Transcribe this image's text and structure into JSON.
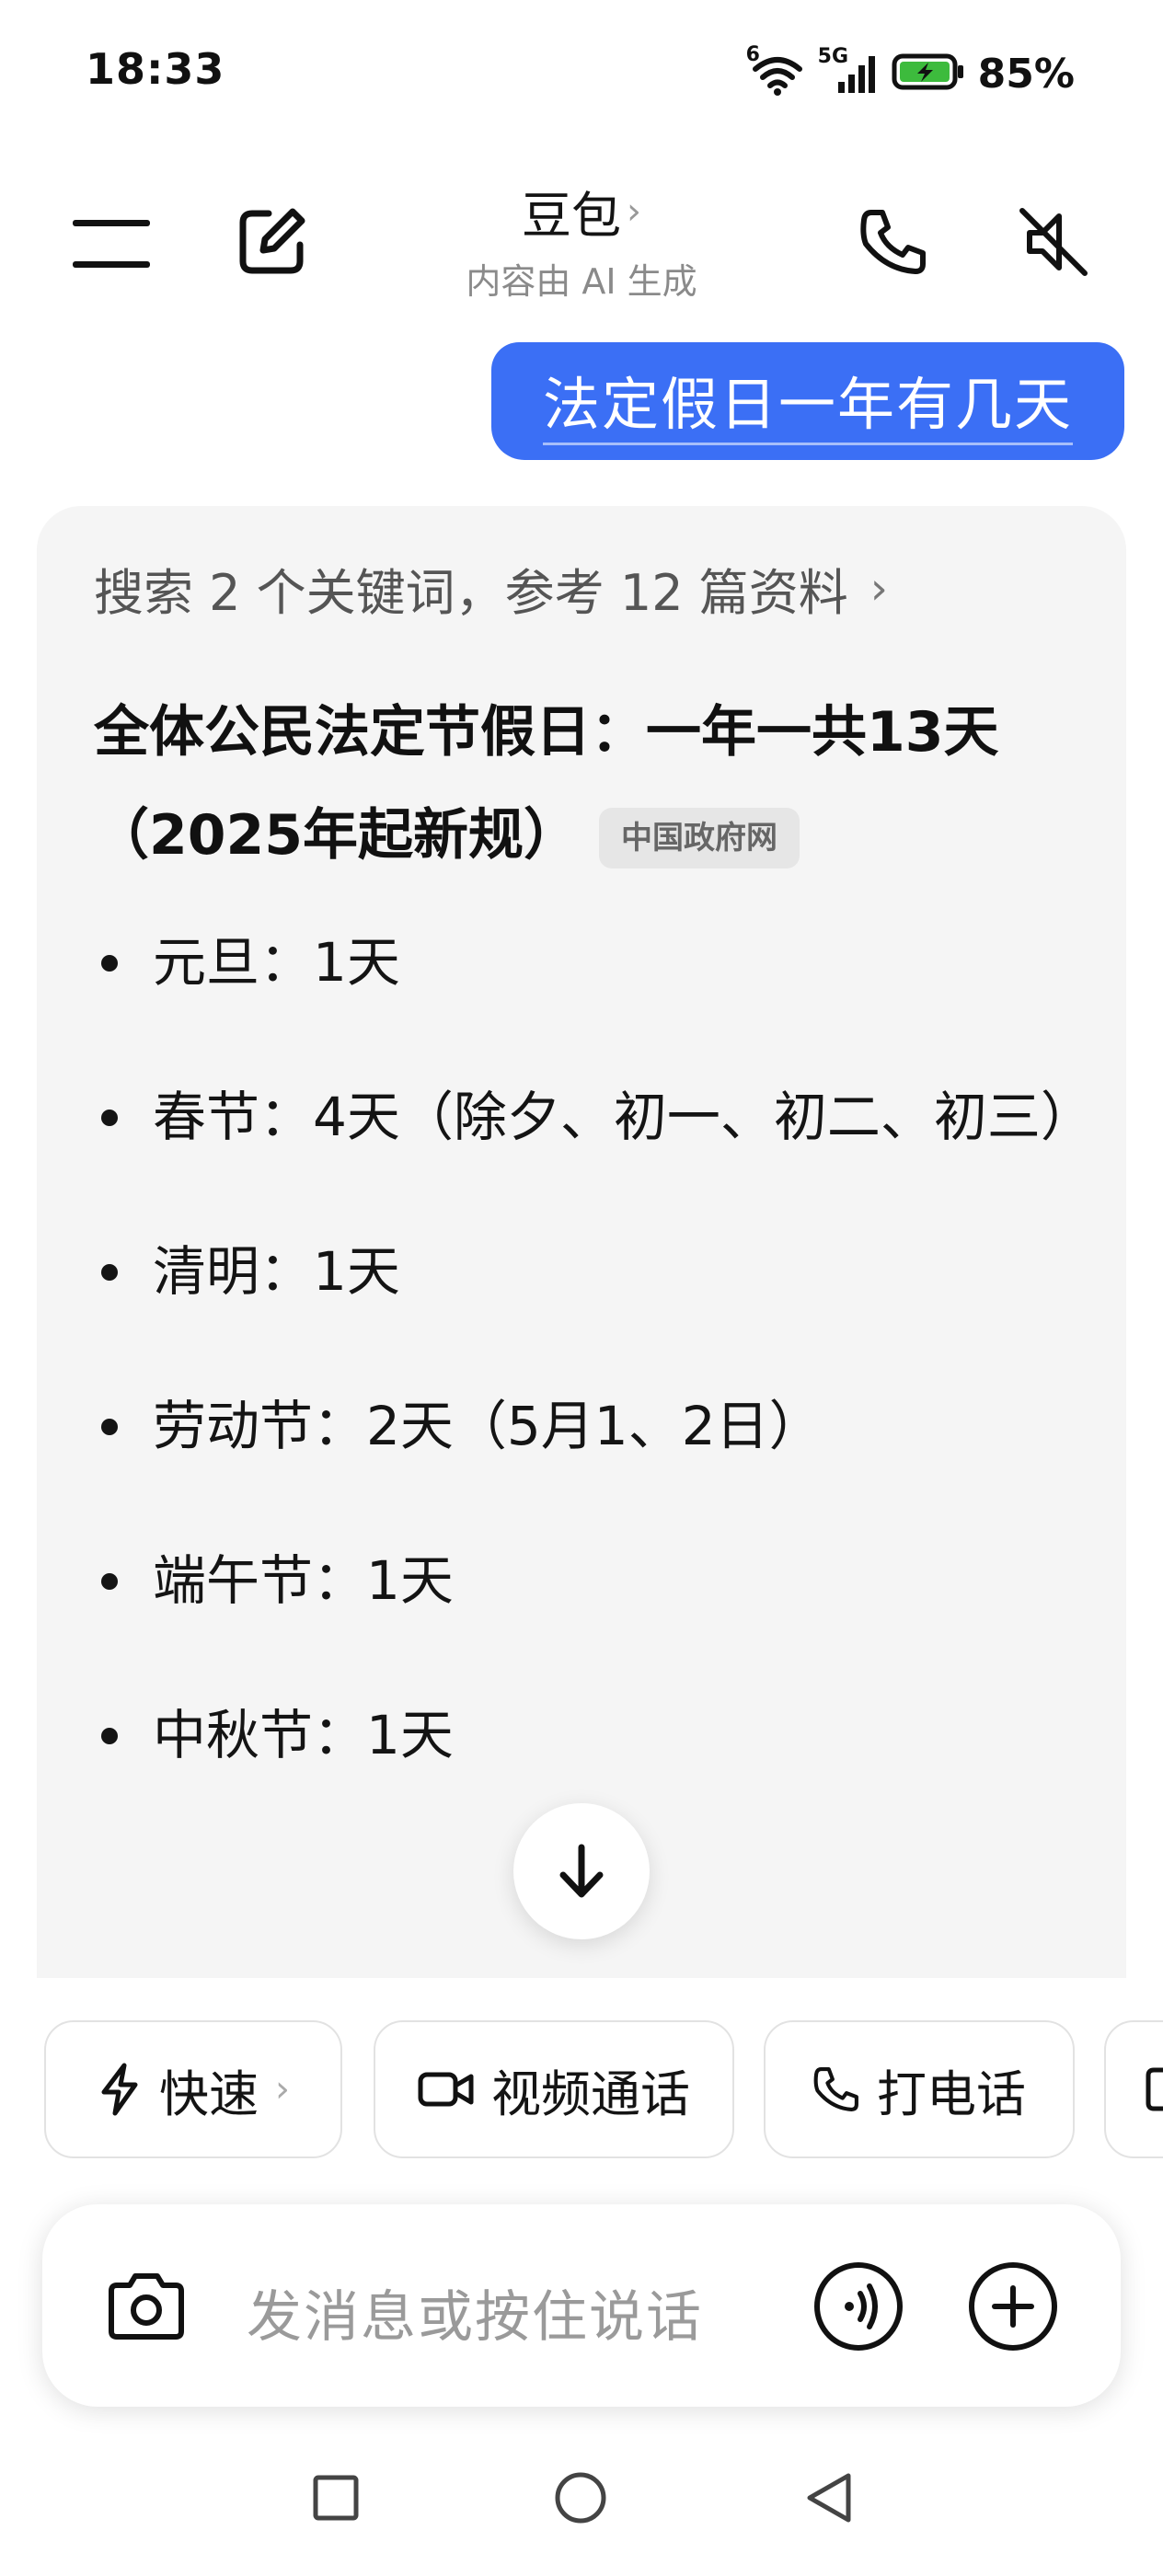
{
  "status_bar": {
    "time": "18:33",
    "network": "5G",
    "wifi_badge": "6",
    "battery_percent": "85%"
  },
  "header": {
    "title": "豆包",
    "subtitle": "内容由 AI 生成"
  },
  "user_message": "法定假日一年有几天",
  "ai_response": {
    "search_summary": "搜索 2 个关键词，参考 12 篇资料",
    "heading": "全体公民法定节假日：一年一共13天（2025年起新规）",
    "source_tag": "中国政府网",
    "holidays": [
      "元旦：1天",
      "春节：4天（除夕、初一、初二、初三）",
      "清明：1天",
      "劳动节：2天（5月1、2日）",
      "端午节：1天",
      "中秋节：1天"
    ]
  },
  "quick_actions": {
    "fast_label": "快速",
    "video_call_label": "视频通话",
    "phone_call_label": "打电话"
  },
  "input": {
    "placeholder": "发消息或按住说话"
  },
  "colors": {
    "accent": "#3b6ff5",
    "card_bg": "#f5f5f5",
    "battery_green": "#3dbb3d"
  }
}
